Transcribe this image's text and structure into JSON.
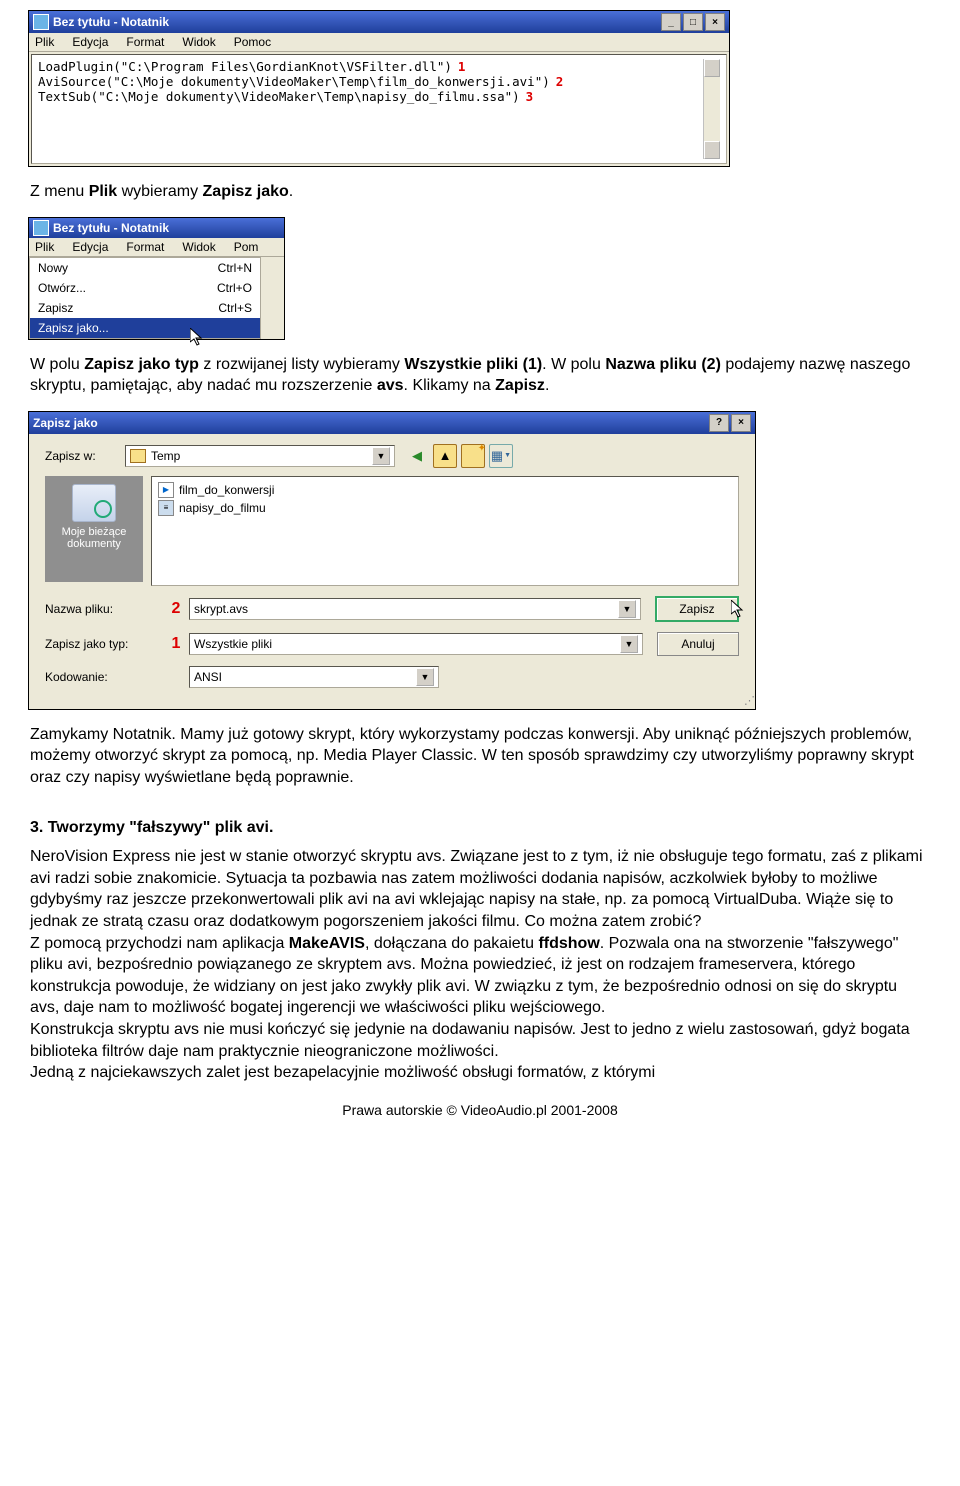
{
  "notepad1": {
    "title": "Bez tytułu - Notatnik",
    "menu": [
      "Plik",
      "Edycja",
      "Format",
      "Widok",
      "Pomoc"
    ],
    "lines": [
      {
        "text": "LoadPlugin(\"C:\\Program Files\\GordianKnot\\VSFilter.dll\")",
        "num": "1"
      },
      {
        "text": "AviSource(\"C:\\Moje dokumenty\\VideoMaker\\Temp\\film_do_konwersji.avi\")",
        "num": "2"
      },
      {
        "text": "TextSub(\"C:\\Moje dokumenty\\VideoMaker\\Temp\\napisy_do_filmu.ssa\")",
        "num": "3"
      }
    ]
  },
  "para1": {
    "pre": "Z menu ",
    "b1": "Plik",
    "mid1": " wybieramy ",
    "b2": "Zapisz jako",
    "suf": "."
  },
  "notepad2": {
    "title": "Bez tytułu - Notatnik",
    "menu": [
      "Plik",
      "Edycja",
      "Format",
      "Widok",
      "Pom"
    ],
    "items": [
      {
        "label": "Nowy",
        "shortcut": "Ctrl+N"
      },
      {
        "label": "Otwórz...",
        "shortcut": "Ctrl+O"
      },
      {
        "label": "Zapisz",
        "shortcut": "Ctrl+S"
      },
      {
        "label": "Zapisz jako...",
        "shortcut": ""
      }
    ]
  },
  "para2": {
    "t1": "W polu ",
    "b1": "Zapisz jako typ",
    "t2": " z rozwijanej listy wybieramy ",
    "b2": "Wszystkie pliki (1)",
    "t3": ". W polu ",
    "b3": "Nazwa pliku (2)",
    "t4": " podajemy nazwę naszego skryptu, pamiętając, aby nadać mu rozszerzenie",
    "b4": "avs",
    "t5": ". Klikamy na ",
    "b5": "Zapisz",
    "t6": "."
  },
  "saveas": {
    "title": "Zapisz jako",
    "saveInLabel": "Zapisz w:",
    "saveInFolder": "Temp",
    "placesLabel": "Moje bieżące dokumenty",
    "files": [
      "film_do_konwersji",
      "napisy_do_filmu"
    ],
    "filenameLabel": "Nazwa pliku:",
    "filenameValue": "skrypt.avs",
    "typeLabel": "Zapisz jako typ:",
    "typeValue": "Wszystkie pliki",
    "encodingLabel": "Kodowanie:",
    "encodingValue": "ANSI",
    "btnSave": "Zapisz",
    "btnCancel": "Anuluj",
    "redFilename": "2",
    "redType": "1"
  },
  "para3": "Zamykamy Notatnik. Mamy już gotowy skrypt, który wykorzystamy podczas konwersji. Aby uniknąć późniejszych problemów, możemy otworzyć skrypt za pomocą, np. Media Player Classic. W ten sposób sprawdzimy czy utworzyliśmy poprawny skrypt oraz czy napisy wyświetlane będą poprawnie.",
  "heading": "3. Tworzymy \"fałszywy\" plik avi.",
  "para4": {
    "seg1": "NeroVision Express nie jest w stanie otworzyć skryptu avs. Związane jest to z tym, iż nie obsługuje tego formatu, zaś z plikami avi radzi sobie znakomicie. Sytuacja ta pozbawia nas zatem możliwości dodania napisów, aczkolwiek byłoby to możliwe gdybyśmy raz jeszcze przekonwertowali plik avi na avi wklejając napisy na stałe, np. za pomocą VirtualDuba. Wiąże się to jednak ze stratą czasu oraz dodatkowym pogorszeniem jakości filmu. Co można zatem zrobić?",
    "seg2a": "Z pomocą przychodzi nam aplikacja ",
    "b1": "MakeAVIS",
    "seg2b": ", dołączana do pakaietu ",
    "b2": "ffdshow",
    "seg2c": ". Pozwala ona na stworzenie \"fałszywego\" pliku avi, bezpośrednio powiązanego ze skryptem avs. Można powiedzieć, iż jest on rodzajem frameservera, którego konstrukcja powoduje, że widziany on jest jako zwykły plik avi. W związku z tym, że bezpośrednio odnosi on się do skryptu avs, daje nam to możliwość bogatej ingerencji we właściwości pliku wejściowego.",
    "seg3": "Konstrukcja skryptu avs nie musi kończyć się jedynie na dodawaniu napisów. Jest to jedno z wielu zastosowań, gdyż bogata biblioteka filtrów daje nam praktycznie nieograniczone możliwości.",
    "seg4": "Jedną z najciekawszych zalet jest bezapelacyjnie możliwość obsługi formatów, z którymi"
  },
  "footer": "Prawa autorskie © VideoAudio.pl 2001-2008"
}
